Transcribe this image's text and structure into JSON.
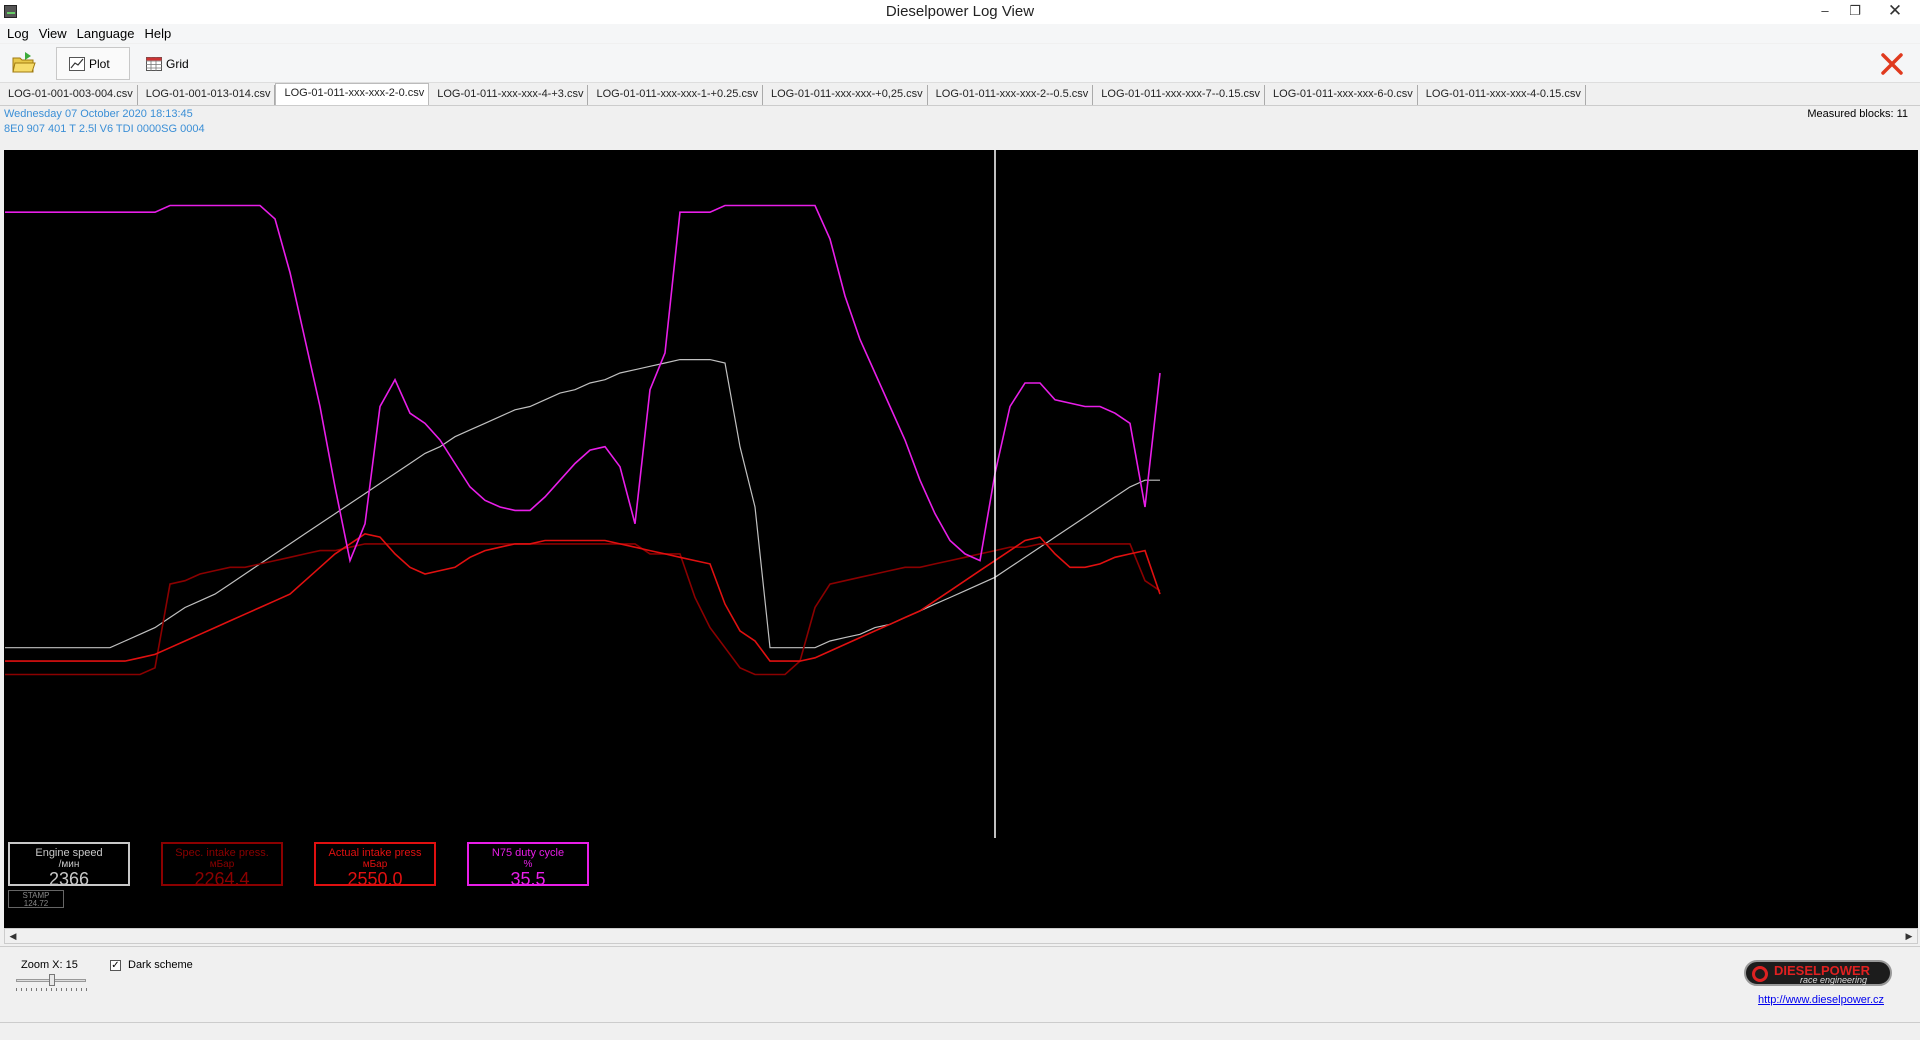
{
  "window": {
    "title": "Dieselpower Log View",
    "min_glyph": "–",
    "restore_glyph": "❐",
    "close_glyph": "✕"
  },
  "menu": [
    {
      "label": "Log"
    },
    {
      "label": "View"
    },
    {
      "label": "Language"
    },
    {
      "label": "Help"
    }
  ],
  "toolbar": {
    "plot_label": "Plot",
    "grid_label": "Grid",
    "active": "Plot"
  },
  "tabs": [
    "LOG-01-001-003-004.csv",
    "LOG-01-001-013-014.csv",
    "LOG-01-011-xxx-xxx-2-0.csv",
    "LOG-01-011-xxx-xxx-4-+3.csv",
    "LOG-01-011-xxx-xxx-1-+0.25.csv",
    "LOG-01-011-xxx-xxx-+0,25.csv",
    "LOG-01-011-xxx-xxx-2--0.5.csv",
    "LOG-01-011-xxx-xxx-7--0.15.csv",
    "LOG-01-011-xxx-xxx-6-0.csv",
    "LOG-01-011-xxx-xxx-4-0.15.csv"
  ],
  "active_tab": 2,
  "info": {
    "date": "Wednesday 07 October 2020 18:13:45",
    "ecu": "8E0 907 401 T  2.5l V6 TDI 0000SG  0004",
    "measured_blocks": "Measured blocks: 11"
  },
  "chart_data": {
    "type": "line",
    "title": "",
    "xlabel": "",
    "ylabel": "",
    "grid": false,
    "background": "#000000",
    "cursor_x": 132,
    "x": [
      0,
      2,
      4,
      6,
      8,
      10,
      12,
      14,
      16,
      18,
      20,
      22,
      24,
      26,
      28,
      30,
      32,
      34,
      36,
      38,
      40,
      42,
      44,
      46,
      48,
      50,
      52,
      54,
      56,
      58,
      60,
      62,
      64,
      66,
      68,
      70,
      72,
      74,
      76,
      78,
      80,
      82,
      84,
      86,
      88,
      90,
      92,
      94,
      96,
      98,
      100,
      102,
      104,
      106,
      108,
      110,
      112,
      114,
      116,
      118,
      120,
      122,
      124,
      126,
      128,
      130,
      132,
      134,
      136,
      138,
      140,
      142,
      144,
      146,
      148,
      150,
      152,
      154
    ],
    "series": [
      {
        "name": "Engine speed",
        "color": "#c0c0c0",
        "values": [
          58,
          58,
          58,
          58,
          58,
          58,
          58,
          58,
          60,
          62,
          64,
          67,
          70,
          72,
          74,
          77,
          80,
          83,
          86,
          89,
          92,
          95,
          98,
          101,
          104,
          107,
          110,
          113,
          116,
          118,
          121,
          123,
          125,
          127,
          129,
          130,
          132,
          134,
          135,
          137,
          138,
          140,
          141,
          142,
          143,
          144,
          144,
          144,
          143,
          118,
          100,
          58,
          58,
          58,
          58,
          60,
          61,
          62,
          64,
          65,
          67,
          69,
          71,
          73,
          75,
          77,
          79,
          82,
          85,
          88,
          91,
          94,
          97,
          100,
          103,
          106,
          108,
          108
        ]
      },
      {
        "name": "Spec. intake press.",
        "color": "#8b0000",
        "values": [
          50,
          50,
          50,
          50,
          50,
          50,
          50,
          50,
          50,
          50,
          52,
          77,
          78,
          80,
          81,
          82,
          82,
          83,
          84,
          85,
          86,
          87,
          87,
          88,
          89,
          89,
          89,
          89,
          89,
          89,
          89,
          89,
          89,
          89,
          89,
          89,
          89,
          89,
          89,
          89,
          89,
          89,
          89,
          86,
          86,
          86,
          73,
          64,
          58,
          52,
          50,
          50,
          50,
          54,
          70,
          77,
          78,
          79,
          80,
          81,
          82,
          82,
          83,
          84,
          85,
          86,
          87,
          88,
          88,
          89,
          89,
          89,
          89,
          89,
          89,
          89,
          78,
          75
        ]
      },
      {
        "name": "Actual intake press",
        "color": "#e01010",
        "values": [
          54,
          54,
          54,
          54,
          54,
          54,
          54,
          54,
          54,
          55,
          56,
          58,
          60,
          62,
          64,
          66,
          68,
          70,
          72,
          74,
          78,
          82,
          86,
          89,
          92,
          91,
          86,
          82,
          80,
          81,
          82,
          85,
          87,
          88,
          89,
          89,
          90,
          90,
          90,
          90,
          90,
          89,
          88,
          87,
          86,
          85,
          84,
          83,
          71,
          63,
          60,
          54,
          54,
          54,
          55,
          57,
          59,
          61,
          63,
          65,
          67,
          69,
          72,
          75,
          78,
          81,
          84,
          87,
          90,
          91,
          86,
          82,
          82,
          83,
          85,
          86,
          87,
          74
        ]
      },
      {
        "name": "N75 duty cycle",
        "color": "#e81ee8",
        "values": [
          188,
          188,
          188,
          188,
          188,
          188,
          188,
          188,
          188,
          188,
          188,
          190,
          190,
          190,
          190,
          190,
          190,
          190,
          186,
          170,
          150,
          130,
          106,
          84,
          95,
          130,
          138,
          128,
          125,
          120,
          113,
          106,
          102,
          100,
          99,
          99,
          103,
          108,
          113,
          117,
          118,
          112,
          95,
          135,
          146,
          188,
          188,
          188,
          190,
          190,
          190,
          190,
          190,
          190,
          190,
          180,
          163,
          150,
          140,
          130,
          120,
          108,
          98,
          90,
          86,
          84,
          110,
          130,
          137,
          137,
          132,
          131,
          130,
          130,
          128,
          125,
          100,
          140
        ]
      }
    ]
  },
  "gauges": [
    {
      "name": "Engine speed",
      "unit": "/мин",
      "value": "2366",
      "color": "#c8c8c8",
      "value_color": "#c8c8c8"
    },
    {
      "name": "Spec. intake press.",
      "unit": "мБар",
      "value": "2264.4",
      "color": "#8b0000",
      "value_color": "#8b0000"
    },
    {
      "name": "Actual intake press",
      "unit": "мБар",
      "value": "2550.0",
      "color": "#e01010",
      "value_color": "#e01010"
    },
    {
      "name": "N75 duty cycle",
      "unit": "%",
      "value": "35.5",
      "color": "#e81ee8",
      "value_color": "#e81ee8"
    }
  ],
  "stamp": {
    "label": "STAMP",
    "value": "124.72"
  },
  "bottom": {
    "zoom_label": "Zoom X: 15",
    "zoom_value": 15,
    "dark_scheme_label": "Dark scheme",
    "dark_scheme_checked": true,
    "logo_text": "DIESELPOWER",
    "logo_sub": "race engineering",
    "url": "http://www.dieselpower.cz"
  }
}
